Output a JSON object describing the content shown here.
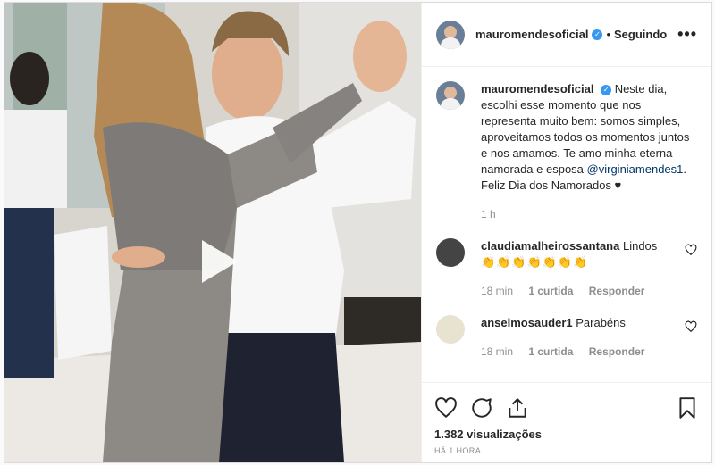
{
  "post": {
    "author": "mauromendesoficial",
    "follow_status": "Seguindo",
    "separator": "•",
    "more_label": "•••",
    "caption_text": "Neste dia, escolhi esse momento que nos representa muito bem: somos simples, aproveitamos todos os momentos juntos e nos amamos. Te amo minha eterna namorada e esposa ",
    "caption_mention": "@virginiamendes1",
    "caption_end": ". Feliz Dia dos Namorados ♥",
    "caption_time": "1 h",
    "views": "1.382 visualizações",
    "posted_ago": "HÁ 1 HORA"
  },
  "comments": [
    {
      "user": "claudiamalheirossantana",
      "text": "Lindos",
      "emoji": "👏👏👏👏👏👏👏",
      "time": "18 min",
      "likes": "1 curtida",
      "reply": "Responder"
    },
    {
      "user": "anselmosauder1",
      "text": "Parabéns",
      "time": "18 min",
      "likes": "1 curtida",
      "reply": "Responder"
    }
  ],
  "icons": {
    "verified": "verified-badge-icon",
    "like": "heart-icon",
    "comment": "comment-icon",
    "share": "share-icon",
    "save": "bookmark-icon",
    "play": "play-icon"
  },
  "colors": {
    "verified": "#3897f0",
    "mention": "#003569",
    "muted": "#8e8e8e"
  }
}
